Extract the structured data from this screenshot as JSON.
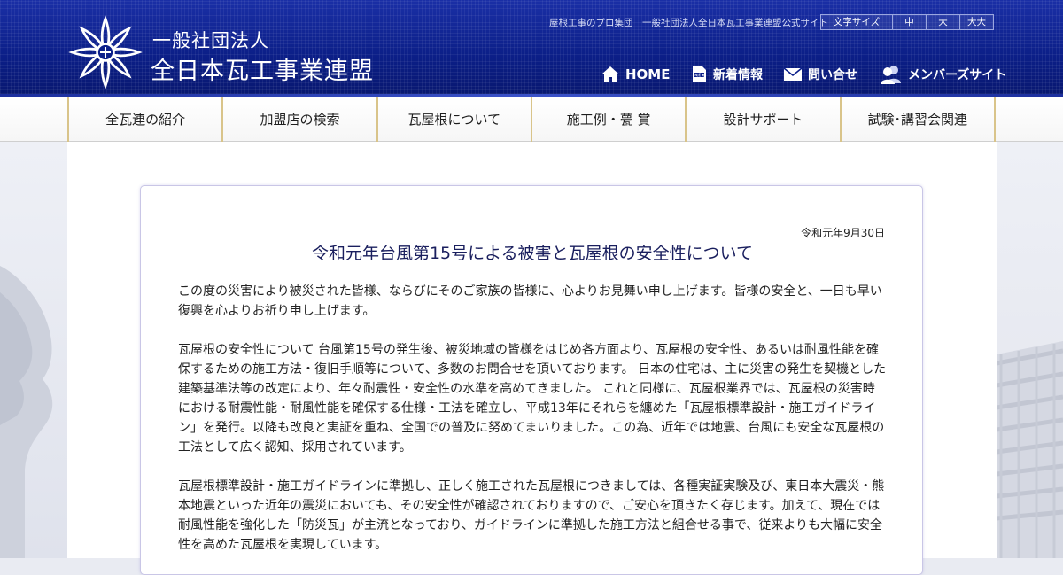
{
  "header": {
    "org_name_line1": "一般社団法人",
    "org_name_line2": "全日本瓦工事業連盟",
    "tagline": "屋根工事のプロ集団　一般社団法人全日本瓦工事業連盟公式サイト",
    "font_size": {
      "label": "文字サイズ",
      "options": [
        "中",
        "大",
        "大大"
      ]
    },
    "nav": [
      {
        "label": "HOME",
        "icon": "home-icon"
      },
      {
        "label": "新着情報",
        "icon": "new-badge-icon"
      },
      {
        "label": "問い合せ",
        "icon": "mail-icon"
      },
      {
        "label": "メンバーズサイト",
        "icon": "members-icon"
      }
    ]
  },
  "main_nav": {
    "items": [
      "全瓦連の紹介",
      "加盟店の検索",
      "瓦屋根について",
      "施工例・甍 賞",
      "設計サポート",
      "試験･講習会関連"
    ]
  },
  "article": {
    "date": "令和元年9月30日",
    "title": "令和元年台風第15号による被害と瓦屋根の安全性について",
    "paragraphs": [
      "この度の災害により被災された皆様、ならびにそのご家族の皆様に、心よりお見舞い申し上げます。皆様の安全と、一日も早い復興を心よりお祈り申し上げます。",
      "瓦屋根の安全性について 台風第15号の発生後、被災地域の皆様をはじめ各方面より、瓦屋根の安全性、あるいは耐風性能を確保するための施工方法・復旧手順等について、多数のお問合せを頂いております。 日本の住宅は、主に災害の発生を契機とした建築基準法等の改定により、年々耐震性・安全性の水準を高めてきました。 これと同様に、瓦屋根業界では、瓦屋根の災害時における耐震性能・耐風性能を確保する仕様・工法を確立し、平成13年にそれらを纏めた「瓦屋根標準設計・施工ガイドライン」を発行。以降も改良と実証を重ね、全国での普及に努めてまいりました。この為、近年では地震、台風にも安全な瓦屋根の工法として広く認知、採用されています。",
      "瓦屋根標準設計・施工ガイドラインに準拠し、正しく施工された瓦屋根につきましては、各種実証実験及び、東日本大震災・熊本地震といった近年の震災においても、その安全性が確認されておりますので、ご安心を頂きたく存じます。加えて、現在では耐風性能を強化した「防災瓦」が主流となっており、ガイドラインに準拠した施工方法と組合せる事で、従来よりも大幅に安全性を高めた瓦屋根を実現しています。"
    ]
  },
  "colors": {
    "header_blue": "#0b1f8a",
    "nav_divider_gold": "#d9c48a",
    "title_navy": "#1a1f5e"
  }
}
